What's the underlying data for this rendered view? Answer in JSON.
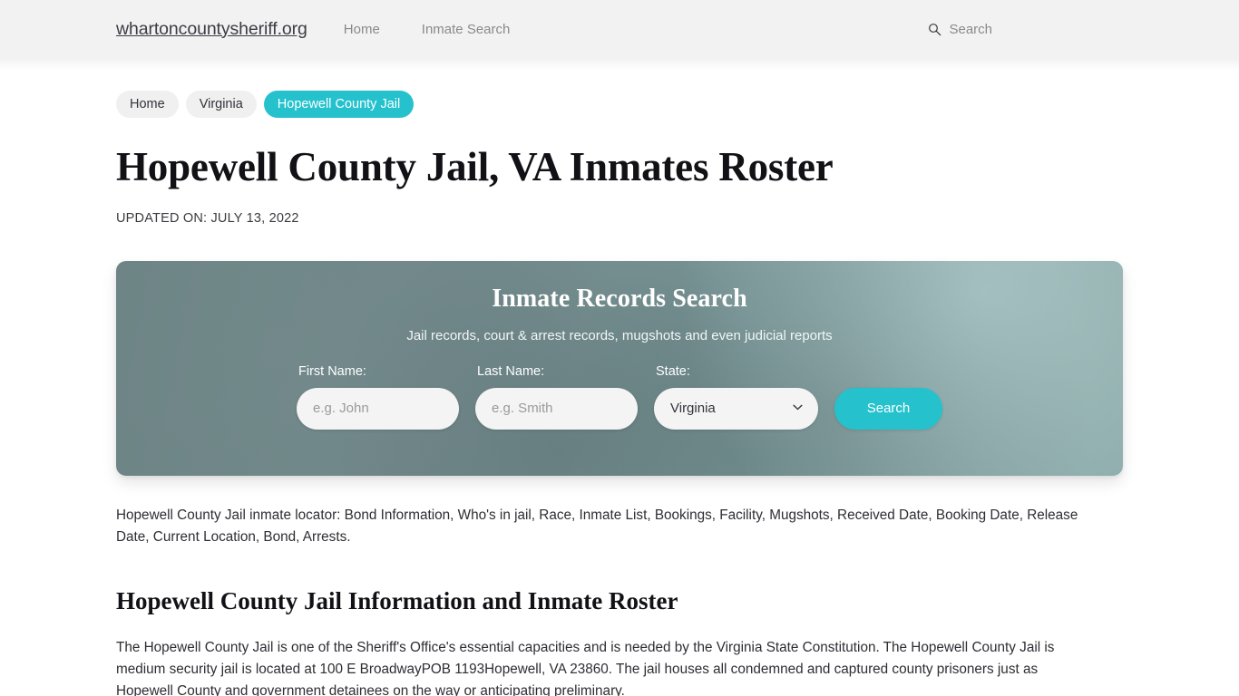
{
  "header": {
    "brand": "whartoncountysheriff.org",
    "nav": [
      {
        "label": "Home"
      },
      {
        "label": "Inmate Search"
      }
    ],
    "search": {
      "icon": "search-icon",
      "label": "Search"
    }
  },
  "breadcrumb": [
    {
      "label": "Home",
      "current": false
    },
    {
      "label": "Virginia",
      "current": false
    },
    {
      "label": "Hopewell County Jail",
      "current": true
    }
  ],
  "main": {
    "title": "Hopewell County Jail, VA Inmates Roster",
    "updated_on": "UPDATED ON: JULY 13, 2022",
    "intro_paragraph": "Hopewell County Jail inmate locator: Bond Information, Who's in jail, Race, Inmate List, Bookings, Facility, Mugshots, Received Date, Booking Date, Release Date, Current Location, Bond, Arrests.",
    "section_heading": "Hopewell County Jail Information and Inmate Roster",
    "section_paragraph": "The Hopewell County Jail is one of the Sheriff's Office's essential capacities and is needed by the Virginia State Constitution. The Hopewell County Jail is medium security jail is located at 100 E BroadwayPOB 1193Hopewell, VA 23860. The jail houses all condemned and captured county prisoners just as Hopewell County and government detainees on the way or anticipating preliminary."
  },
  "search_card": {
    "title": "Inmate Records Search",
    "subtitle": "Jail records, court & arrest records, mugshots and even judicial reports",
    "fields": {
      "first_name": {
        "label": "First Name:",
        "value": "",
        "placeholder": "e.g. John"
      },
      "last_name": {
        "label": "Last Name:",
        "value": "",
        "placeholder": "e.g. Smith"
      },
      "state": {
        "label": "State:",
        "selected": "Virginia"
      }
    },
    "submit_label": "Search"
  },
  "colors": {
    "accent_teal": "#25c2ce",
    "header_bg": "#f2f2f2",
    "card_base": "#7a9293",
    "crumb_bg": "#f0f0f0",
    "page_bg": "#ffffff"
  }
}
